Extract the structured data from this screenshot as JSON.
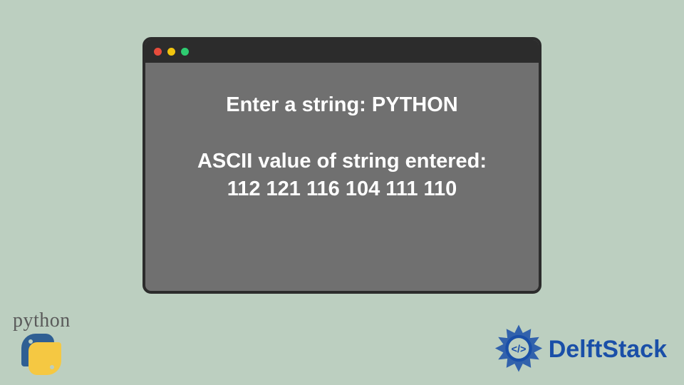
{
  "terminal": {
    "line1": "Enter a string: PYTHON",
    "line2": "ASCII value of string entered:",
    "line3": "112 121 116 104 111 110"
  },
  "logos": {
    "python_text": "python",
    "delft_text": "DelftStack"
  },
  "colors": {
    "background": "#bccfc0",
    "window_bg": "#707070",
    "window_border": "#2c2c2c",
    "dot_red": "#e74c3c",
    "dot_yellow": "#f1c40f",
    "dot_green": "#2ecc71",
    "python_blue": "#2f5f93",
    "python_yellow": "#f5c842",
    "delft_blue": "#1a4fa8"
  }
}
